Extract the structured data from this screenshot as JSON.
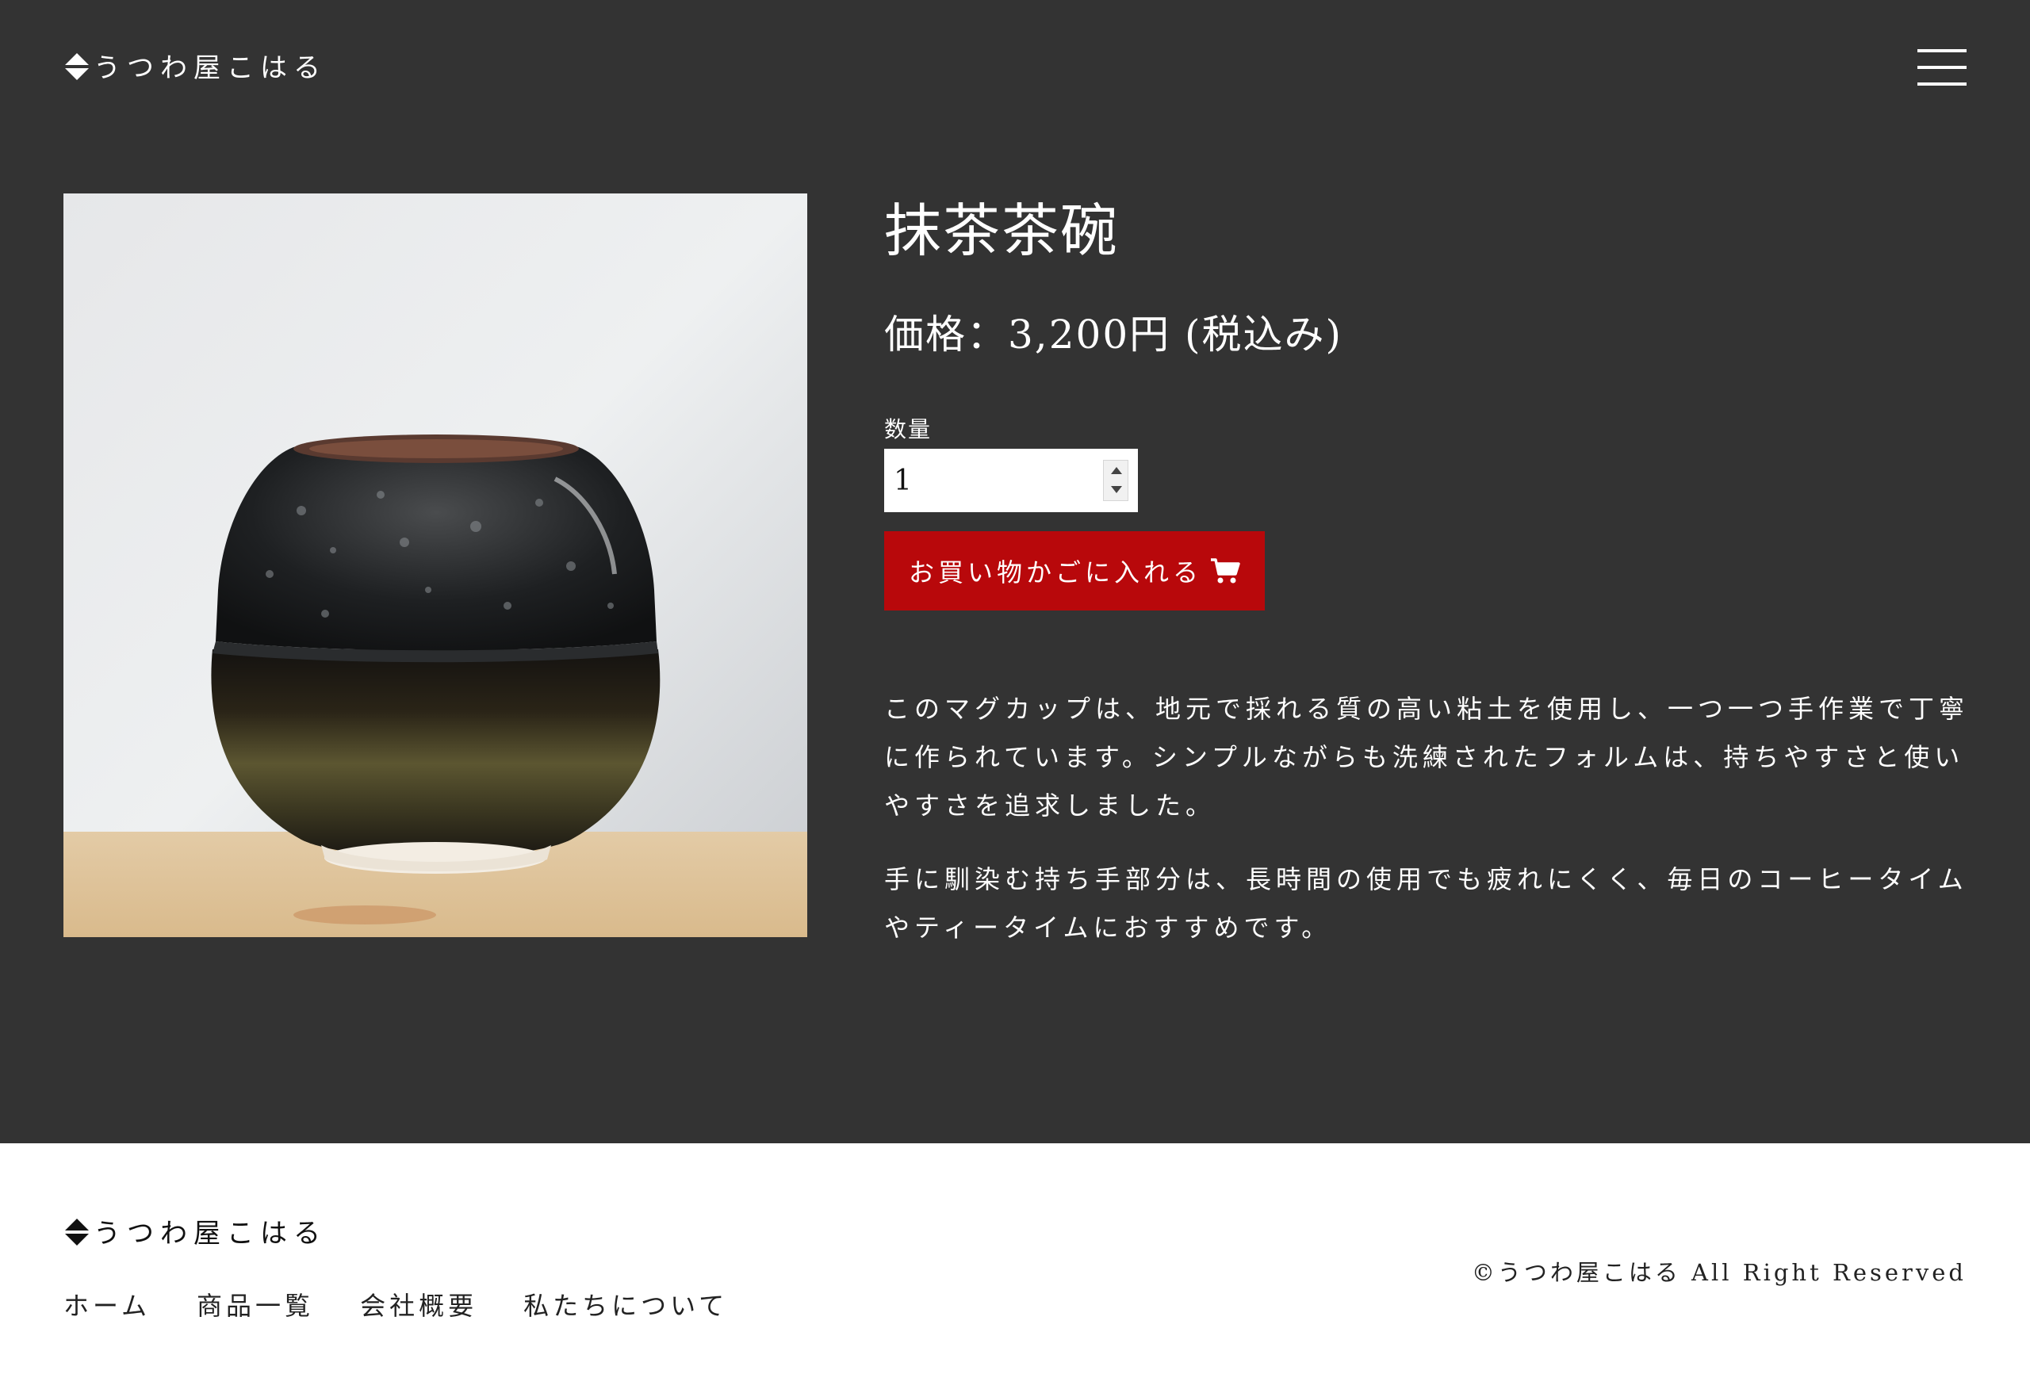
{
  "header": {
    "logo_text": "うつわ屋こはる",
    "menu_icon": "hamburger-menu-icon"
  },
  "product": {
    "image_alt": "抹茶茶碗",
    "title": "抹茶茶碗",
    "price": "価格：3,200円 (税込み)",
    "quantity_label": "数量",
    "quantity_value": "1",
    "cart_button_label": "お買い物かごに入れる",
    "cart_icon": "shopping-cart-icon",
    "accent_color": "#b8080b",
    "description": [
      "このマグカップは、地元で採れる質の高い粘土を使用し、一つ一つ手作業で丁寧に作られています。シンプルながらも洗練されたフォルムは、持ちやすさと使いやすさを追求しました。",
      "手に馴染む持ち手部分は、長時間の使用でも疲れにくく、毎日のコーヒータイムやティータイムにおすすめです。"
    ]
  },
  "footer": {
    "logo_text": "うつわ屋こはる",
    "nav": [
      "ホーム",
      "商品一覧",
      "会社概要",
      "私たちについて"
    ],
    "copyright": "©うつわ屋こはる All Right Reserved"
  },
  "colors": {
    "main_background": "#333333",
    "footer_background": "#ffffff"
  }
}
